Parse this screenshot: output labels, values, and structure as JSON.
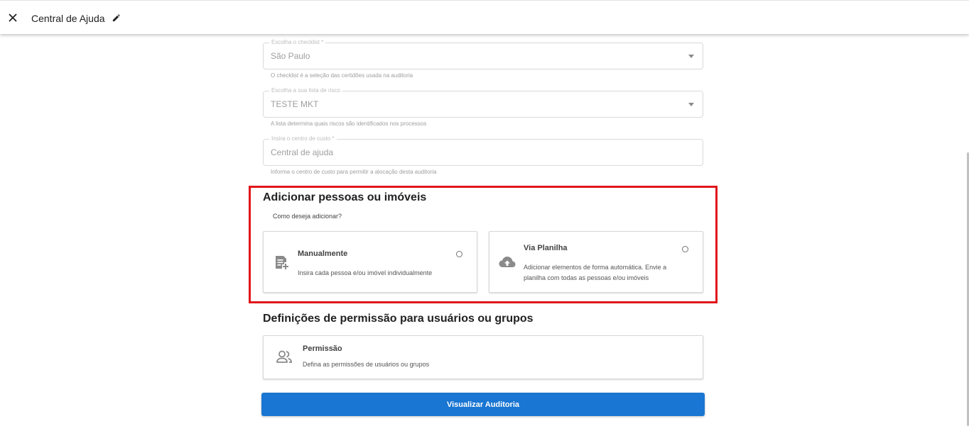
{
  "header": {
    "title": "Central de Ajuda",
    "close_icon": "close-icon",
    "edit_icon": "pencil-icon"
  },
  "form": {
    "checklist": {
      "label": "Escolha o checklist *",
      "value": "São Paulo",
      "helper": "O checklist é a seleção das certidões usada na auditoria"
    },
    "risk_list": {
      "label": "Escolha a sua lista de risco",
      "value": "TESTE MKT",
      "helper": "A lista determina quais riscos são identificados nos processos"
    },
    "cost_center": {
      "label": "Insira o centro de custo *",
      "value": "Central de ajuda",
      "helper": "Informa o centro de custo para permitir a alocação desta auditoria"
    }
  },
  "add_section": {
    "title": "Adicionar pessoas ou imóveis",
    "question": "Como deseja adicionar?",
    "highlight_color": "#e0161b",
    "options": [
      {
        "title": "Manualmente",
        "description": "Insira cada pessoa e/ou imóvel individualmente",
        "icon": "note-add-icon",
        "selected": false
      },
      {
        "title": "Via Planilha",
        "description_line1": "Adicionar elementos de forma automática. Envie a",
        "description_line2": "planilha com todas as pessoas e/ou imóveis",
        "icon": "cloud-upload-icon",
        "selected": false
      }
    ]
  },
  "permission_section": {
    "title": "Definições de permissão para usuários ou grupos",
    "card": {
      "title": "Permissão",
      "description": "Defina as permissões de usuários ou grupos",
      "icon": "people-icon"
    }
  },
  "actions": {
    "primary_label": "Visualizar Auditoria",
    "primary_color": "#1976d2"
  }
}
